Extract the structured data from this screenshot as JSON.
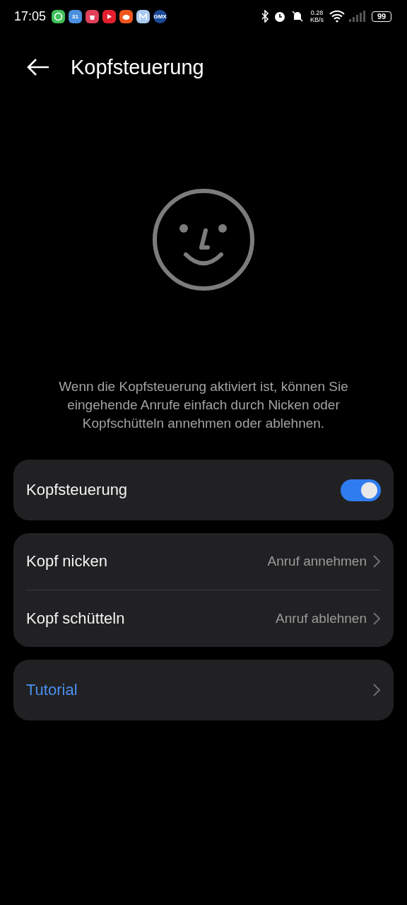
{
  "status_bar": {
    "time": "17:05",
    "notifications": [
      {
        "kind": "chat",
        "color": "#3fc05a"
      },
      {
        "kind": "calendar",
        "color": "#4a8fe0",
        "label": "31"
      },
      {
        "kind": "bag",
        "color": "#e0405a"
      },
      {
        "kind": "play",
        "color": "#e5202e"
      },
      {
        "kind": "robot",
        "color": "#f0561f"
      },
      {
        "kind": "mail",
        "color": "#a9c9f0"
      },
      {
        "kind": "badge",
        "color": "#1c4a9a",
        "label": "GMX"
      }
    ],
    "speed_value": "0.28",
    "speed_unit": "KB/s",
    "battery": "99"
  },
  "header": {
    "title": "Kopfsteuerung"
  },
  "description": "Wenn die Kopfsteuerung aktiviert ist, können Sie eingehende Anrufe einfach durch Nicken oder Kopfschütteln annehmen oder ablehnen.",
  "toggle_card": {
    "label": "Kopfsteuerung",
    "on": true
  },
  "gesture_card": [
    {
      "label": "Kopf nicken",
      "value": "Anruf annehmen"
    },
    {
      "label": "Kopf schütteln",
      "value": "Anruf ablehnen"
    }
  ],
  "tutorial": {
    "label": "Tutorial"
  }
}
